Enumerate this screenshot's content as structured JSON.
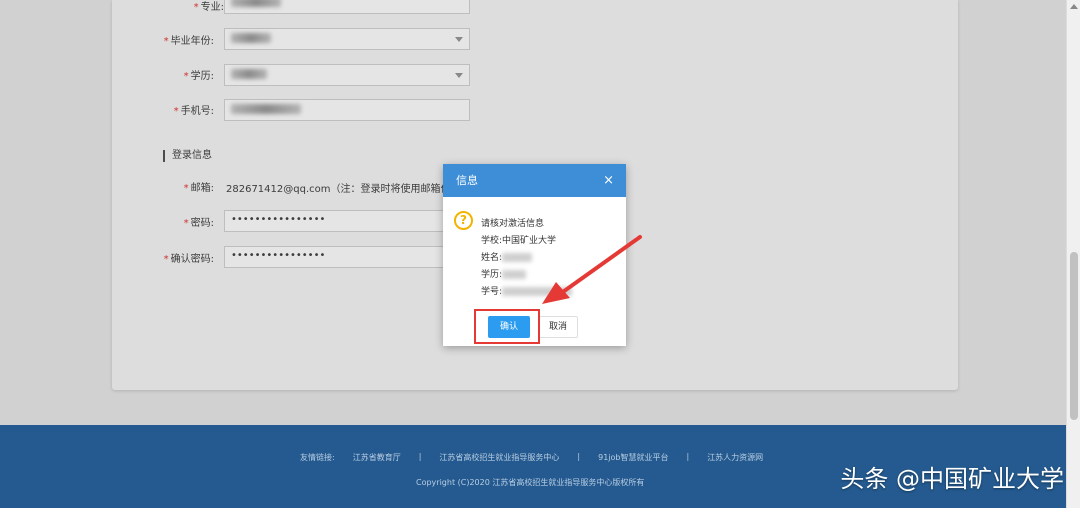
{
  "form": {
    "major_label": "专业:",
    "grad_year_label": "毕业年份:",
    "education_label": "学历:",
    "phone_label": "手机号:",
    "login_section_title": "登录信息",
    "email_label": "邮箱:",
    "email_value": "282671412@qq.com（注：登录时将使用邮箱作为",
    "password_label": "密码:",
    "password_value": "••••••••••••••••",
    "confirm_password_label": "确认密码:",
    "confirm_password_value": "••••••••••••••••",
    "required_mark": "*"
  },
  "modal": {
    "title": "信息",
    "close_icon": "×",
    "question_icon": "?",
    "message": "请核对激活信息",
    "school": "学校:中国矿业大学",
    "name_label": "姓名:",
    "education_label": "学历:",
    "student_id_label": "学号:",
    "confirm_label": "确认",
    "cancel_label": "取消"
  },
  "footer": {
    "links_label": "友情链接:",
    "links": [
      "江苏省教育厅",
      "江苏省高校招生就业指导服务中心",
      "91job智慧就业平台",
      "江苏人力资源网"
    ],
    "separator": "|",
    "copyright": "Copyright (C)2020 江苏省高校招生就业指导服务中心版权所有"
  },
  "watermark": "头条 @中国矿业大学",
  "colors": {
    "modal_header": "#3d8ed7",
    "confirm_button": "#2b9cf0",
    "footer": "#245a8f",
    "highlight": "#e53935"
  }
}
